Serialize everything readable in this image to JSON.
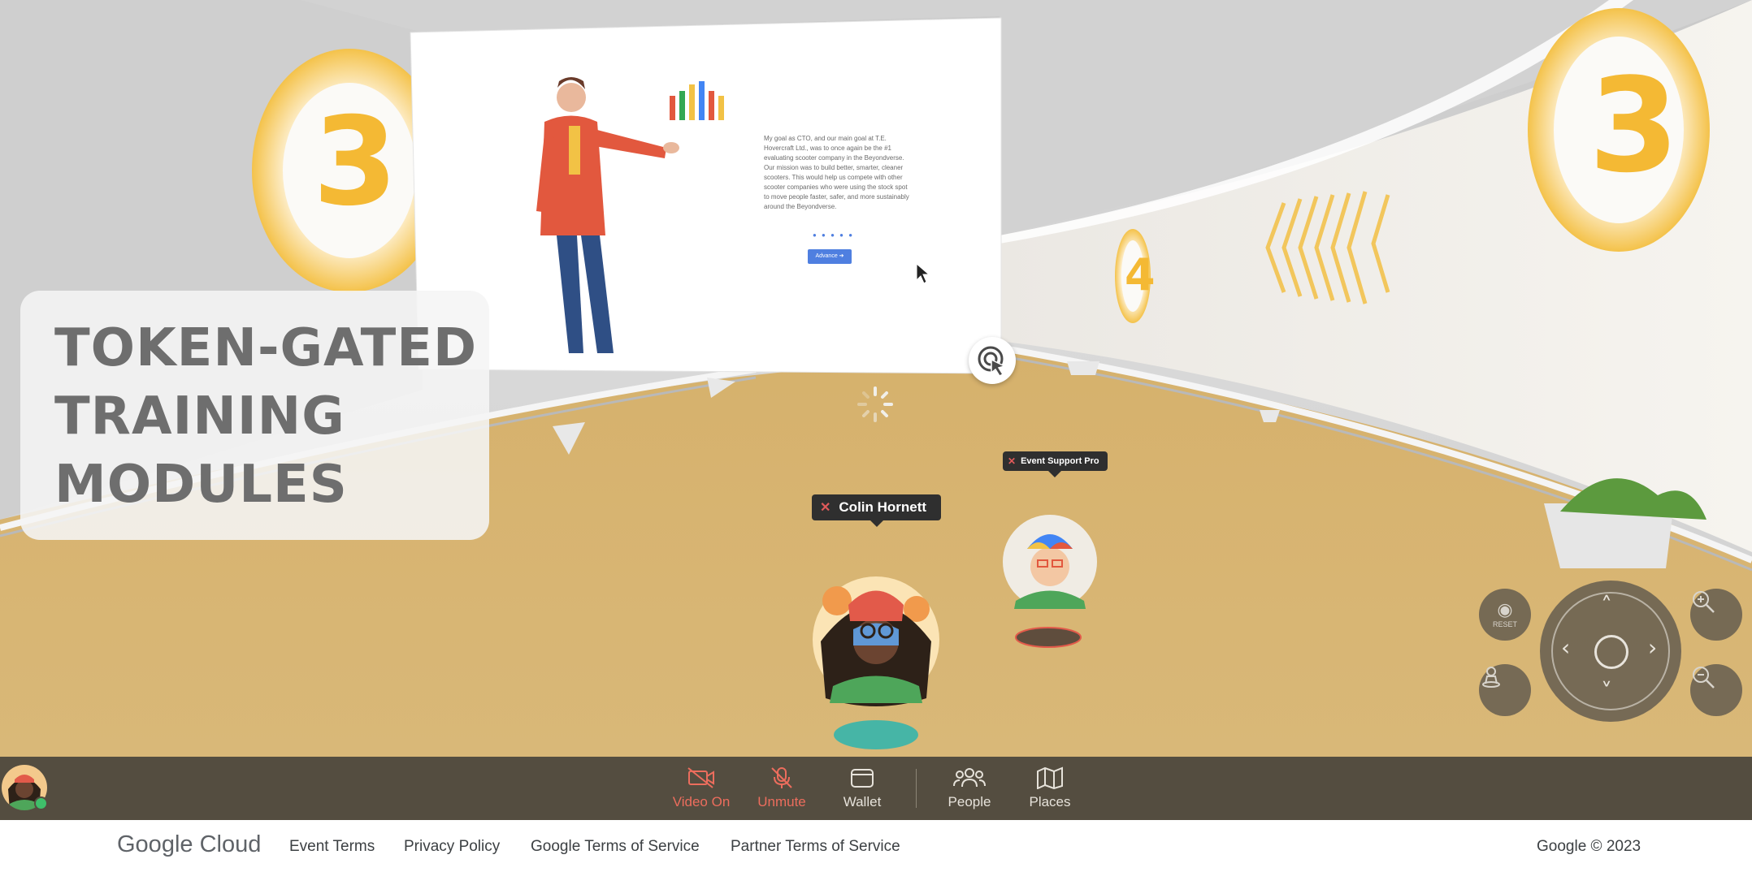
{
  "scene": {
    "big_number_left": "3",
    "big_number_right": "3",
    "small_number": "4",
    "slide": {
      "body": "My goal as CTO, and our main goal at T.E. Hovercraft Ltd., was to once again be the #1 evaluating scooter company in the Beyondverse. Our mission was to build better, smarter, cleaner scooters. This would help us compete with other scooter companies who were using the stock spot to move people faster, safer, and more sustainably around the Beyondverse.",
      "dots": "● ● ● ● ●",
      "button_label": "Advance ➔"
    },
    "title_card": {
      "line1": "TOKEN-GATED",
      "line2": "TRAINING",
      "line3": "MODULES"
    },
    "avatars": [
      {
        "name": "Colin Hornett"
      },
      {
        "name": "Event Support Pro"
      }
    ],
    "controls": {
      "reset_label": "RESET",
      "reset_icon": "eye-icon",
      "avatar_icon": "person-icon",
      "zoom_in_icon": "zoom-in-icon",
      "zoom_out_icon": "zoom-out-icon"
    }
  },
  "toolbar": {
    "items": [
      {
        "label": "Video On",
        "icon": "video-off-icon",
        "state": "off"
      },
      {
        "label": "Unmute",
        "icon": "mic-off-icon",
        "state": "off"
      },
      {
        "label": "Wallet",
        "icon": "wallet-icon",
        "state": "on"
      },
      {
        "label": "People",
        "icon": "people-icon",
        "state": "on"
      },
      {
        "label": "Places",
        "icon": "map-icon",
        "state": "on"
      }
    ],
    "accent_off": "#ec6d5d",
    "background": "#544d40"
  },
  "footer": {
    "logo": "Google Cloud",
    "links": [
      "Event Terms",
      "Privacy Policy",
      "Google Terms of Service",
      "Partner Terms of Service"
    ],
    "copyright": "Google © 2023"
  }
}
